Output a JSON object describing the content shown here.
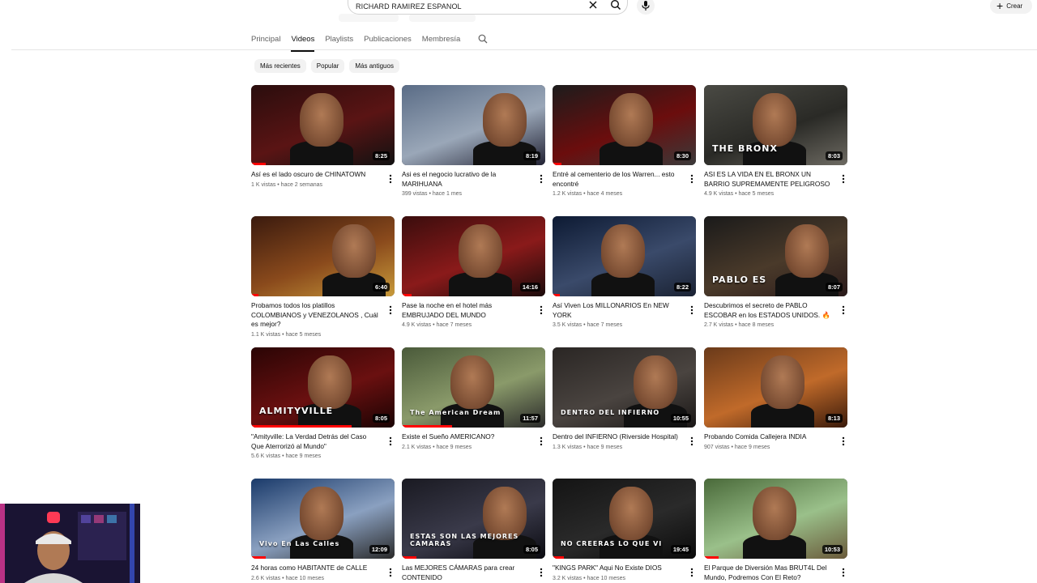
{
  "search": {
    "query": "RICHARD RAMIREZ ESPANOL"
  },
  "header": {
    "create_label": "Crear"
  },
  "tabs": [
    {
      "label": "Principal"
    },
    {
      "label": "Videos"
    },
    {
      "label": "Playlists"
    },
    {
      "label": "Publicaciones"
    },
    {
      "label": "Membresía"
    }
  ],
  "chips": [
    {
      "label": "Más recientes"
    },
    {
      "label": "Popular"
    },
    {
      "label": "Más antiguos"
    }
  ],
  "videos": [
    {
      "title": "Así es el lado oscuro de CHINATOWN",
      "meta": "1 K vistas • hace 2 semanas",
      "duration": "8:25",
      "progress": 0.1,
      "overlay": ""
    },
    {
      "title": "Asi es el negocio lucrativo de la MARIHUANA",
      "meta": "399 vistas • hace 1 mes",
      "duration": "8:19",
      "progress": 0,
      "overlay": ""
    },
    {
      "title": "Entré al cementerio de los Warren... esto encontré",
      "meta": "1.2 K vistas • hace 4 meses",
      "duration": "8:30",
      "progress": 0.06,
      "overlay": ""
    },
    {
      "title": "ASI ES LA VIDA EN EL BRONX UN BARRIO SUPREMAMENTE PELIGROSO",
      "meta": "4.9 K vistas • hace 5 meses",
      "duration": "8:03",
      "progress": 0,
      "overlay": "THE BRONX"
    },
    {
      "title": "Probamos todos los platillos COLOMBIANOS y VENEZOLANOS , Cuál es mejor?",
      "meta": "1.1 K vistas • hace 5 meses",
      "duration": "6:40",
      "progress": 0.05,
      "overlay": ""
    },
    {
      "title": "Pase la noche en el hotel más EMBRUJADO DEL MUNDO",
      "meta": "4.9 K vistas • hace 7 meses",
      "duration": "14:16",
      "progress": 0.07,
      "overlay": ""
    },
    {
      "title": "Así Viven Los MILLONARIOS En NEW YORK",
      "meta": "3.5 K vistas • hace 7 meses",
      "duration": "8:22",
      "progress": 0.05,
      "overlay": ""
    },
    {
      "title": "Descubrimos el secreto de PABLO ESCOBAR en los ESTADOS UNIDOS. 🔥",
      "meta": "2.7 K vistas • hace 8 meses",
      "duration": "8:07",
      "progress": 0,
      "overlay": "PABLO ES"
    },
    {
      "title": "\"Amityville: La Verdad Detrás del Caso Que Aterrorizó al Mundo\"",
      "meta": "5.6 K vistas • hace 9 meses",
      "duration": "8:05",
      "progress": 0.7,
      "overlay": "ALMITYVILLE"
    },
    {
      "title": "Existe el Sueño AMERICANO?",
      "meta": "2.1 K vistas • hace 9 meses",
      "duration": "11:57",
      "progress": 0.35,
      "overlay": "The American Dream"
    },
    {
      "title": "Dentro del INFIERNO (Riverside Hospital)",
      "meta": "1.3 K vistas • hace 9 meses",
      "duration": "10:55",
      "progress": 0,
      "overlay": "DENTRO DEL INFIERNO"
    },
    {
      "title": "Probando Comida Callejera INDIA",
      "meta": "907 vistas • hace 9 meses",
      "duration": "8:13",
      "progress": 0,
      "overlay": ""
    },
    {
      "title": "24 horas como HABITANTE de CALLE",
      "meta": "2.6 K vistas • hace 10 meses",
      "duration": "12:09",
      "progress": 0.1,
      "overlay": "Vivo En Las Calles"
    },
    {
      "title": "Las MEJORES CÁMARAS para crear CONTENIDO",
      "meta": "",
      "duration": "8:05",
      "progress": 0.1,
      "overlay": "ESTAS SON LAS MEJORES CAMARAS"
    },
    {
      "title": "\"KINGS PARK\" Aqui No Existe DIOS",
      "meta": "3.2 K vistas • hace 10 meses",
      "duration": "19:45",
      "progress": 0.08,
      "overlay": "NO CREERAS LO QUE VI"
    },
    {
      "title": "El Parque de Diversión Mas BRUT4L Del Mundo, Podremos Con El Reto?",
      "meta": "",
      "duration": "10:53",
      "progress": 0.1,
      "overlay": ""
    }
  ],
  "colors": {
    "accent": "#ff0000",
    "text": "#0f0f0f",
    "muted": "#606060",
    "chip": "#f2f2f2"
  }
}
